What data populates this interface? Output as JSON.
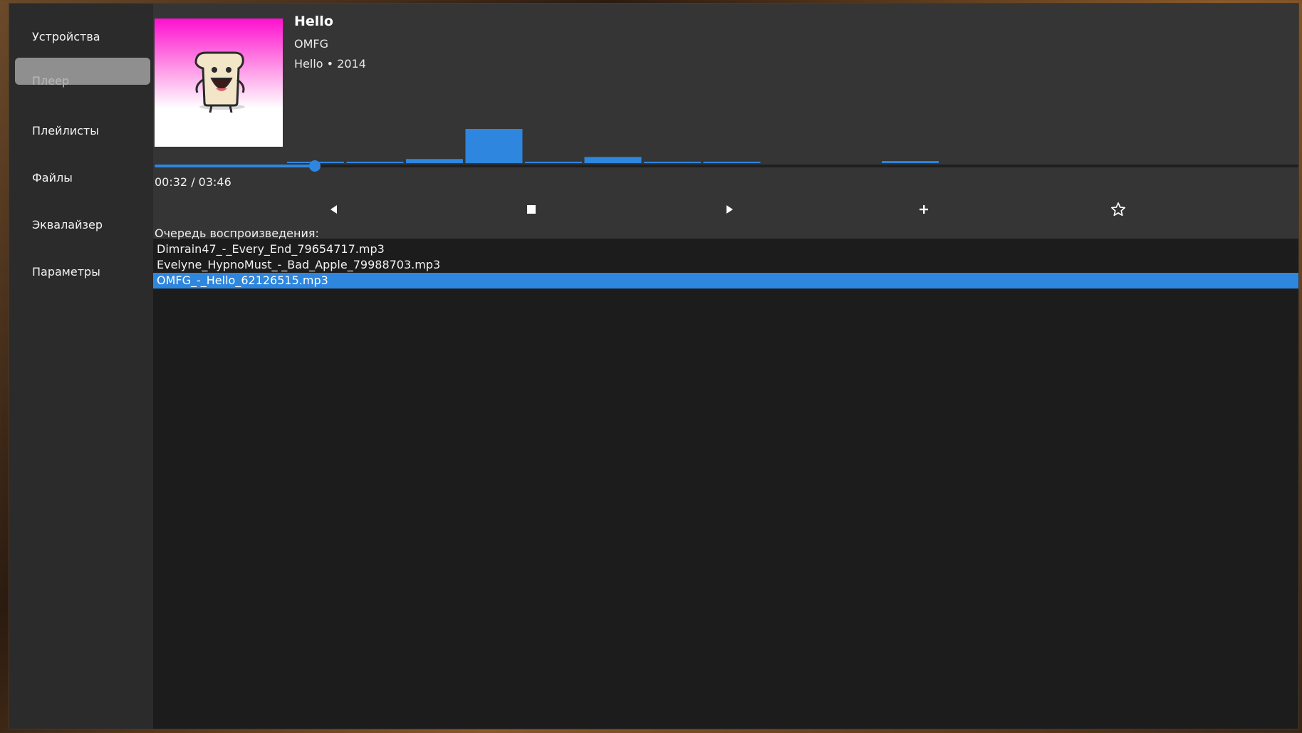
{
  "sidebar": {
    "items": [
      {
        "label": "Устройства",
        "active": false
      },
      {
        "label": "Плеер",
        "active": true
      },
      {
        "label": "Плейлисты",
        "active": false
      },
      {
        "label": "Файлы",
        "active": false
      },
      {
        "label": "Эквалайзер",
        "active": false
      },
      {
        "label": "Параметры",
        "active": false
      }
    ]
  },
  "now_playing": {
    "title": "Hello",
    "artist": "OMFG",
    "album_line": "Hello • 2014",
    "time": "00:32 / 03:46",
    "progress": 0.14
  },
  "visualizer": {
    "levels": [
      0.02,
      0.02,
      0.12,
      1.0,
      0.04,
      0.18,
      0.04,
      0.02,
      0,
      0,
      0.06
    ],
    "color": "#2e86de"
  },
  "controls": {
    "prev_icon": "prev-icon",
    "stop_icon": "stop-icon",
    "play_icon": "play-icon",
    "add_icon": "plus-icon",
    "favorite_icon": "star-icon"
  },
  "queue": {
    "label": "Очередь воспроизведения:",
    "items": [
      "Dimrain47_-_Every_End_79654717.mp3",
      "Evelyne_HypnoMust_-_Bad_Apple_79988703.mp3",
      "OMFG_-_Hello_62126515.mp3"
    ],
    "selected_index": 2
  },
  "colors": {
    "accent": "#2e86de",
    "sidebar_bg": "#2b2b2b",
    "panel_bg": "#353535",
    "list_bg": "#1c1c1c"
  }
}
